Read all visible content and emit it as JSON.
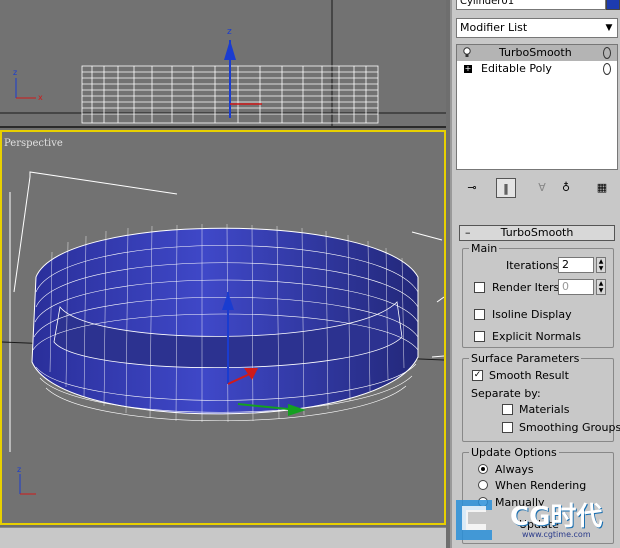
{
  "viewports": {
    "top_label": "",
    "perspective_label": "Perspective",
    "frame_color": "#e8d000",
    "mesh_color": "#2a2f9a"
  },
  "panel": {
    "object_name": "Cylinder01",
    "object_color": "#1d3bb0",
    "modifier_list_label": "Modifier List",
    "stack": [
      {
        "label": "TurboSmooth",
        "selected": true
      },
      {
        "label": "Editable Poly",
        "selected": false
      }
    ],
    "toolbar": [
      "pin-stack-icon",
      "show-end-result-icon",
      "make-unique-icon",
      "remove-modifier-icon",
      "configure-sets-icon"
    ]
  },
  "turbosmooth": {
    "rollout_title": "TurboSmooth",
    "main": {
      "title": "Main",
      "iterations_label": "Iterations:",
      "iterations_value": "2",
      "render_iters_label": "Render Iters:",
      "render_iters_value": "0",
      "isoline_label": "Isoline Display",
      "explicit_normals_label": "Explicit Normals"
    },
    "surface": {
      "title": "Surface Parameters",
      "smooth_result_label": "Smooth Result",
      "smooth_result_checked": true,
      "separate_by_label": "Separate by:",
      "materials_label": "Materials",
      "smoothing_groups_label": "Smoothing Groups"
    },
    "update": {
      "title": "Update Options",
      "always_label": "Always",
      "when_rendering_label": "When Rendering",
      "manually_label": "Manually",
      "update_button_label": "Update",
      "selected": "Always"
    }
  },
  "watermark": {
    "text": "CG时代",
    "url": "www.cgtime.com"
  }
}
